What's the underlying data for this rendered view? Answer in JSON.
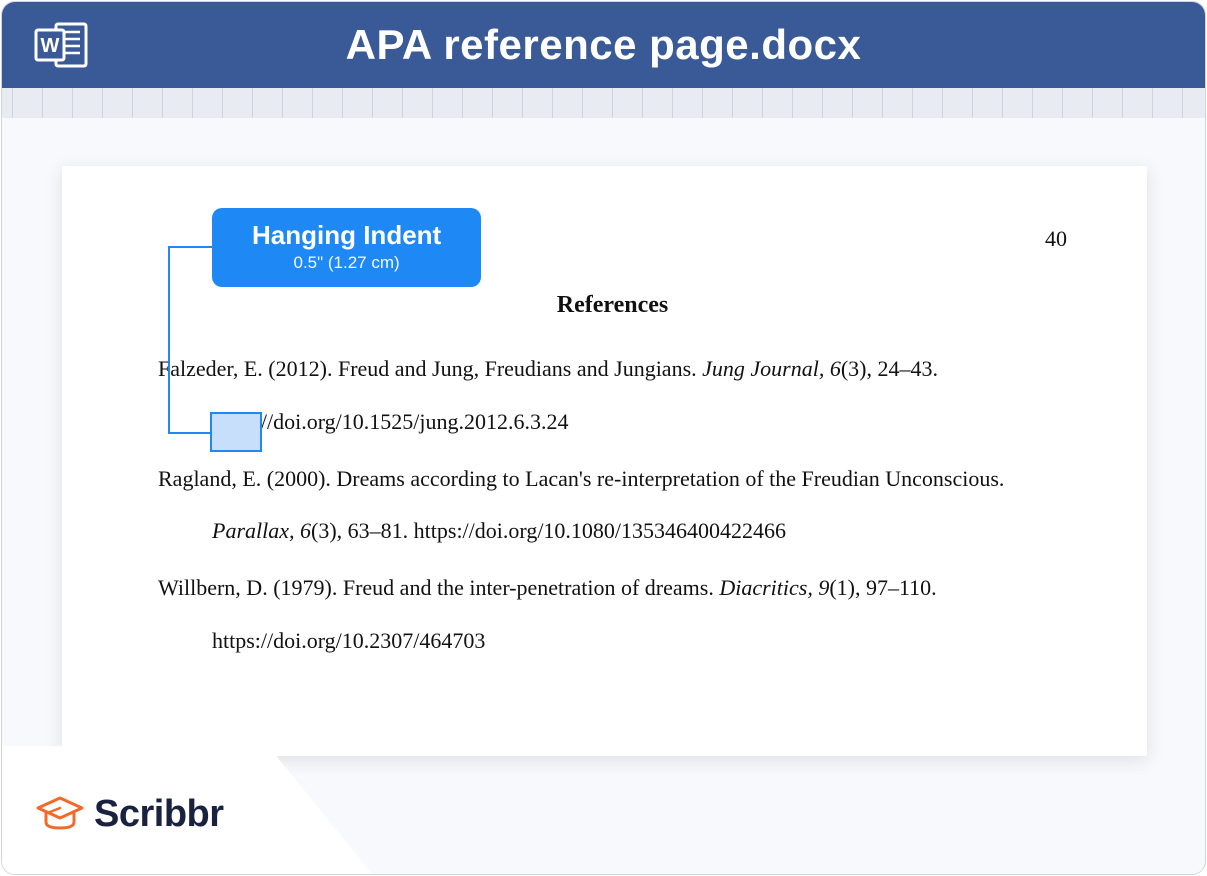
{
  "header": {
    "title": "APA reference page.docx"
  },
  "document": {
    "page_number": "40",
    "heading": "References",
    "references": [
      {
        "author_year": "Falzeder, E. (2012). ",
        "title": "Freud and Jung, Freudians and Jungians. ",
        "journal_ital": "Jung Journal, 6",
        "issue_pages": "(3), 24–43. ",
        "doi": "https://doi.org/10.1525/jung.2012.6.3.24"
      },
      {
        "author_year": "Ragland, E. (2000). ",
        "title": "Dreams according to Lacan's re-interpretation of the Freudian Unconscious. ",
        "journal_ital": "Parallax, 6",
        "issue_pages": "(3), 63–81. ",
        "doi": "https://doi.org/10.1080/135346400422466"
      },
      {
        "author_year": "Willbern, D. (1979). ",
        "title": "Freud and the inter-penetration of dreams. ",
        "journal_ital": "Diacritics, 9",
        "issue_pages": "(1), 97–110. ",
        "doi": "https://doi.org/10.2307/464703"
      }
    ]
  },
  "callout": {
    "title": "Hanging Indent",
    "sub": "0.5\" (1.27 cm)"
  },
  "brand": "Scribbr"
}
